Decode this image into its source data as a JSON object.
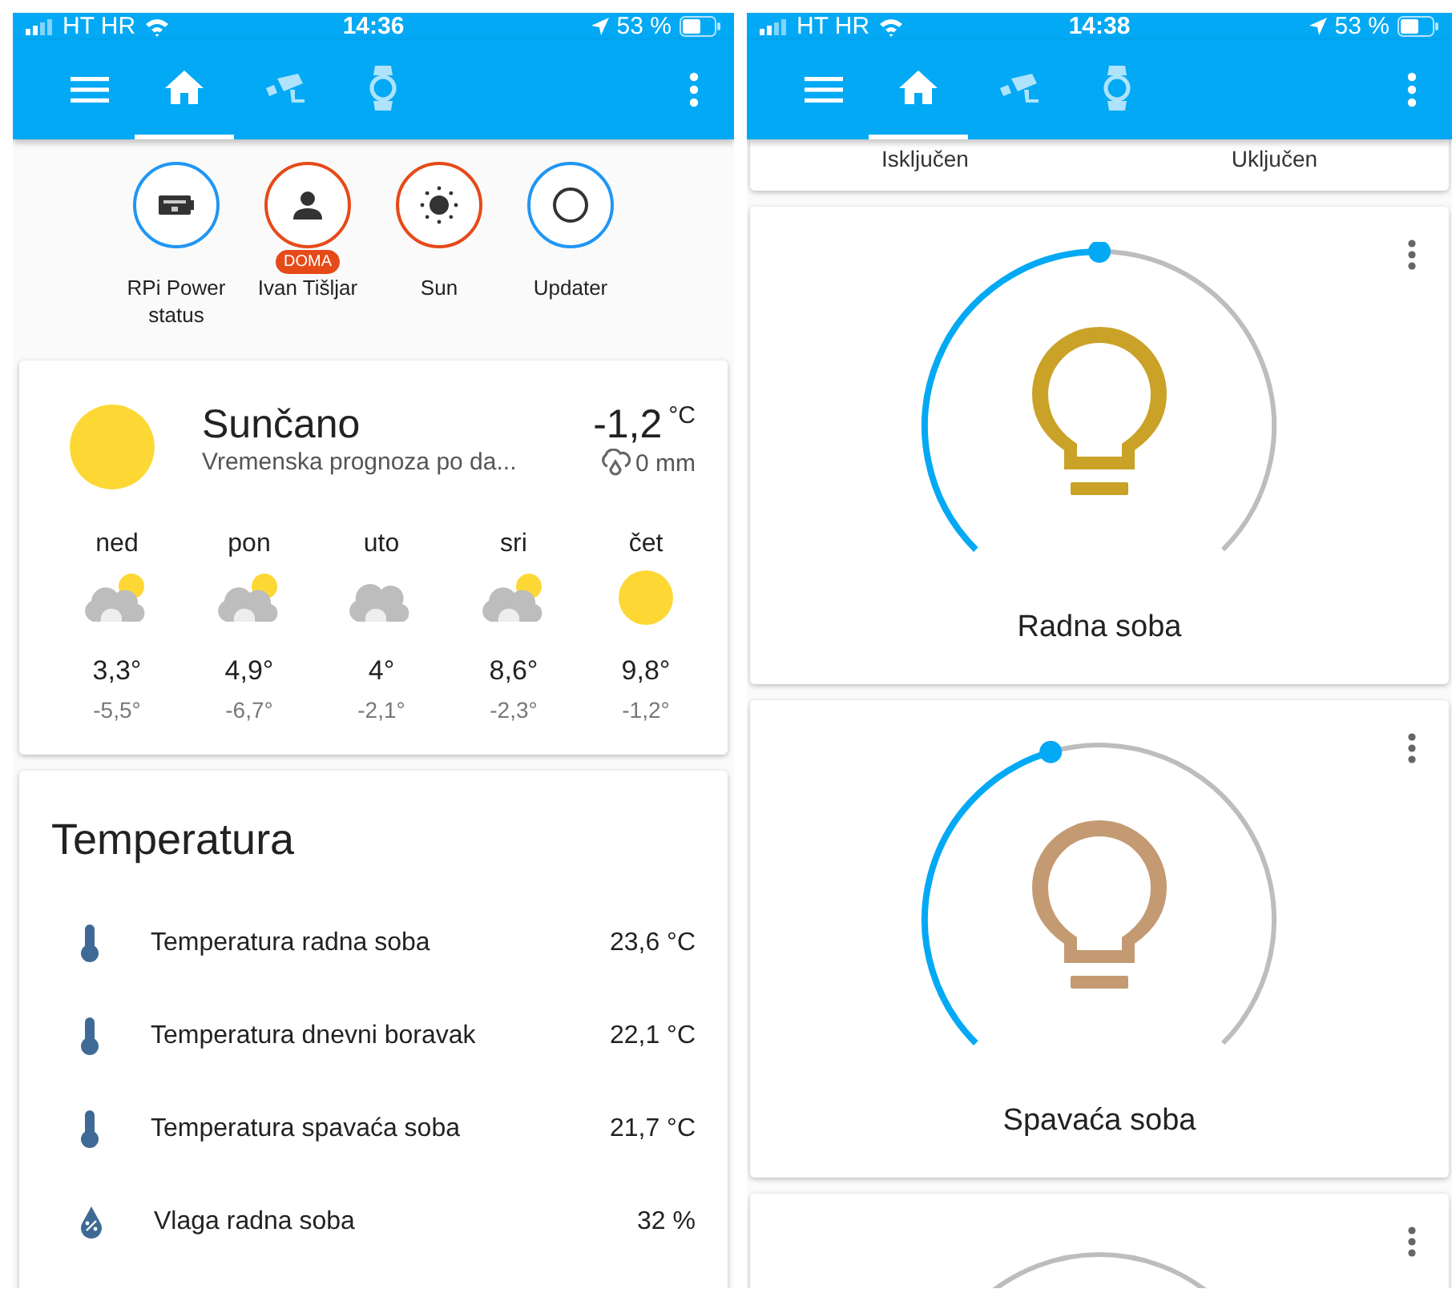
{
  "phones": [
    {
      "status_bar": {
        "carrier": "HT HR",
        "time": "14:36",
        "battery": "53 %"
      },
      "tabs": [
        {
          "kind": "home",
          "selected": true
        },
        {
          "kind": "camera",
          "selected": false
        },
        {
          "kind": "watch",
          "selected": false
        }
      ],
      "badges": [
        {
          "label": "RPi Power status",
          "kind": "board",
          "color": "#2196f3"
        },
        {
          "label": "Ivan Tišljar",
          "kind": "person",
          "color": "#e64a19",
          "tag": "DOMA"
        },
        {
          "label": "Sun",
          "kind": "sun",
          "color": "#e64a19"
        },
        {
          "label": "Updater",
          "kind": "ring",
          "color": "#2196f3"
        }
      ],
      "weather": {
        "condition": "Sunčano",
        "subtitle": "Vremenska prognoza po da...",
        "temperature": "-1,2",
        "unit": "°C",
        "precipitation": "0 mm",
        "forecast": [
          {
            "day": "ned",
            "kind": "partly_cloudy",
            "high": "3,3°",
            "low": "-5,5°"
          },
          {
            "day": "pon",
            "kind": "partly_cloudy",
            "high": "4,9°",
            "low": "-6,7°"
          },
          {
            "day": "uto",
            "kind": "cloudy",
            "high": "4°",
            "low": "-2,1°"
          },
          {
            "day": "sri",
            "kind": "partly_cloudy",
            "high": "8,6°",
            "low": "-2,3°"
          },
          {
            "day": "čet",
            "kind": "sunny",
            "high": "9,8°",
            "low": "-1,2°"
          }
        ]
      },
      "temperature_card": {
        "title": "Temperatura",
        "rows": [
          {
            "kind": "thermometer",
            "name": "Temperatura radna soba",
            "value": "23,6 °C"
          },
          {
            "kind": "thermometer",
            "name": "Temperatura dnevni boravak",
            "value": "22,1 °C"
          },
          {
            "kind": "thermometer",
            "name": "Temperatura spavaća soba",
            "value": "21,7 °C"
          },
          {
            "kind": "humidity",
            "name": "Vlaga radna soba",
            "value": "32 %"
          }
        ]
      }
    },
    {
      "status_bar": {
        "carrier": "HT HR",
        "time": "14:38",
        "battery": "53 %"
      },
      "tabs": [
        {
          "kind": "home",
          "selected": true
        },
        {
          "kind": "camera",
          "selected": false
        },
        {
          "kind": "watch",
          "selected": false
        }
      ],
      "switch_labels": [
        "Isključen",
        "Uključen"
      ],
      "lights": [
        {
          "name": "Radna soba",
          "level": 0.5,
          "color": "#c9a227"
        },
        {
          "name": "Spavaća soba",
          "level": 0.44,
          "color": "#c49a72"
        }
      ]
    }
  ]
}
